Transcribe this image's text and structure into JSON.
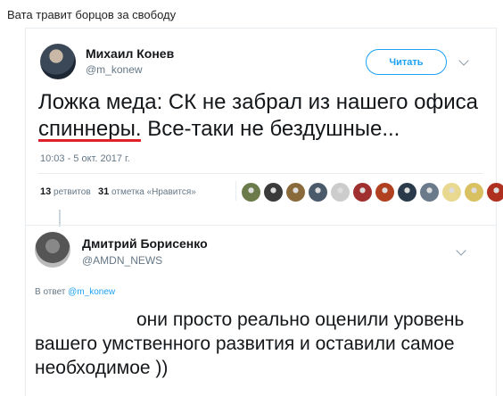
{
  "caption": "Вата травит борцов за свободу",
  "tweet": {
    "author_name": "Михаил Конев",
    "author_handle": "@m_konew",
    "follow_label": "Читать",
    "text": "Ложка меда: СК не забрал из нашего офиса спиннеры. Все-таки не бездушные...",
    "timestamp": "10:03 - 5 окт. 2017 г.",
    "retweets_count": "13",
    "retweets_label": "ретвитов",
    "likes_count": "31",
    "likes_label": "отметка «Нравится»",
    "liker_colors": [
      "#6b7a4a",
      "#3a3a3a",
      "#8a6a3a",
      "#4a5a6a",
      "#cccccc",
      "#a03030",
      "#b04020",
      "#2a3a4a",
      "#6a7a8a",
      "#e8d890",
      "#d9c060",
      "#b03020"
    ]
  },
  "reply": {
    "author_name": "Дмитрий Борисенко",
    "author_handle": "@AMDN_NEWS",
    "reply_prefix": "В ответ",
    "reply_to": "@m_konew",
    "text": "они просто реально оценили уровень вашего умственного развития и оставили самое необходимое ))"
  }
}
